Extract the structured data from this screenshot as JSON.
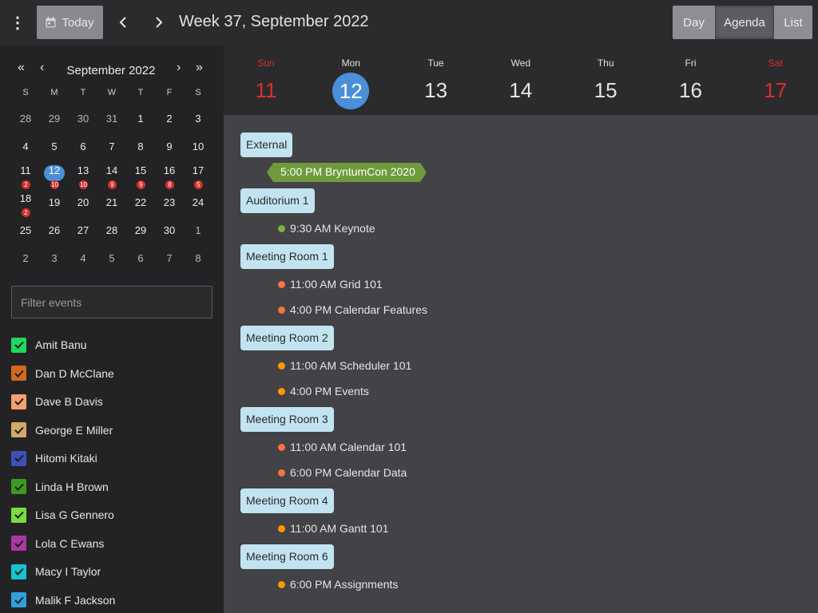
{
  "toolbar": {
    "menu_icon": "vertical-dots-icon",
    "today_label": "Today",
    "today_icon": "calendar-icon",
    "title": "Week 37, September 2022",
    "views": [
      {
        "label": "Day",
        "active": false
      },
      {
        "label": "Agenda",
        "active": true
      },
      {
        "label": "List",
        "active": false
      }
    ]
  },
  "datepicker": {
    "month_label": "September 2022",
    "dow": [
      "S",
      "M",
      "T",
      "W",
      "T",
      "F",
      "S"
    ],
    "weeks": [
      [
        {
          "d": "28",
          "o": true
        },
        {
          "d": "29",
          "o": true
        },
        {
          "d": "30",
          "o": true
        },
        {
          "d": "31",
          "o": true
        },
        {
          "d": "1"
        },
        {
          "d": "2"
        },
        {
          "d": "3"
        }
      ],
      [
        {
          "d": "4"
        },
        {
          "d": "5"
        },
        {
          "d": "6"
        },
        {
          "d": "7"
        },
        {
          "d": "8"
        },
        {
          "d": "9"
        },
        {
          "d": "10"
        }
      ],
      [
        {
          "d": "11",
          "c": "2"
        },
        {
          "d": "12",
          "c": "10",
          "t": true
        },
        {
          "d": "13",
          "c": "10"
        },
        {
          "d": "14",
          "c": "9"
        },
        {
          "d": "15",
          "c": "9"
        },
        {
          "d": "16",
          "c": "8"
        },
        {
          "d": "17",
          "c": "5"
        }
      ],
      [
        {
          "d": "18",
          "c": "2"
        },
        {
          "d": "19"
        },
        {
          "d": "20"
        },
        {
          "d": "21"
        },
        {
          "d": "22"
        },
        {
          "d": "23"
        },
        {
          "d": "24"
        }
      ],
      [
        {
          "d": "25"
        },
        {
          "d": "26"
        },
        {
          "d": "27"
        },
        {
          "d": "28"
        },
        {
          "d": "29"
        },
        {
          "d": "30"
        },
        {
          "d": "1",
          "o": true
        }
      ],
      [
        {
          "d": "2",
          "o": true
        },
        {
          "d": "3",
          "o": true
        },
        {
          "d": "4",
          "o": true
        },
        {
          "d": "5",
          "o": true
        },
        {
          "d": "6",
          "o": true
        },
        {
          "d": "7",
          "o": true
        },
        {
          "d": "8",
          "o": true
        }
      ]
    ]
  },
  "filter": {
    "placeholder": "Filter events",
    "value": ""
  },
  "resources": [
    {
      "name": "Amit Banu",
      "color": "#1ed760"
    },
    {
      "name": "Dan D McClane",
      "color": "#d2691e"
    },
    {
      "name": "Dave B Davis",
      "color": "#f4a070"
    },
    {
      "name": "George E Miller",
      "color": "#d4a865"
    },
    {
      "name": "Hitomi Kitaki",
      "color": "#3f51b5"
    },
    {
      "name": "Linda H Brown",
      "color": "#3c9a1e"
    },
    {
      "name": "Lisa G Gennero",
      "color": "#7cdb3c"
    },
    {
      "name": "Lola C Ewans",
      "color": "#a63aa0"
    },
    {
      "name": "Macy I Taylor",
      "color": "#17c3cf"
    },
    {
      "name": "Malik F Jackson",
      "color": "#2f9fe0"
    }
  ],
  "week": [
    {
      "name": "Sun",
      "num": "11",
      "weekend": true,
      "today": false
    },
    {
      "name": "Mon",
      "num": "12",
      "weekend": false,
      "today": true
    },
    {
      "name": "Tue",
      "num": "13",
      "weekend": false,
      "today": false
    },
    {
      "name": "Wed",
      "num": "14",
      "weekend": false,
      "today": false
    },
    {
      "name": "Thu",
      "num": "15",
      "weekend": false,
      "today": false
    },
    {
      "name": "Fri",
      "num": "16",
      "weekend": false,
      "today": false
    },
    {
      "name": "Sat",
      "num": "17",
      "weekend": true,
      "today": false
    }
  ],
  "agenda": {
    "groups": [
      {
        "label": "External"
      },
      {
        "label": "Auditorium 1"
      },
      {
        "label": "Meeting Room 1"
      },
      {
        "label": "Meeting Room 2"
      },
      {
        "label": "Meeting Room 3"
      },
      {
        "label": "Meeting Room 4"
      },
      {
        "label": "Meeting Room 6"
      }
    ],
    "allday_event": {
      "label": "5:00 PM BryntumCon 2020",
      "color": "#6f9a3c"
    },
    "events": [
      {
        "label": "9:30 AM Keynote",
        "color": "#7cb342"
      },
      {
        "label": "11:00 AM Grid 101",
        "color": "#ff7043"
      },
      {
        "label": "4:00 PM Calendar Features",
        "color": "#ff7043"
      },
      {
        "label": "11:00 AM Scheduler 101",
        "color": "#ff9800"
      },
      {
        "label": "4:00 PM Events",
        "color": "#ff9800"
      },
      {
        "label": "11:00 AM Calendar 101",
        "color": "#ff7043"
      },
      {
        "label": "6:00 PM Calendar Data",
        "color": "#ff7043"
      },
      {
        "label": "11:00 AM Gantt 101",
        "color": "#ff9800"
      },
      {
        "label": "6:00 PM Assignments",
        "color": "#ff9800"
      }
    ]
  }
}
